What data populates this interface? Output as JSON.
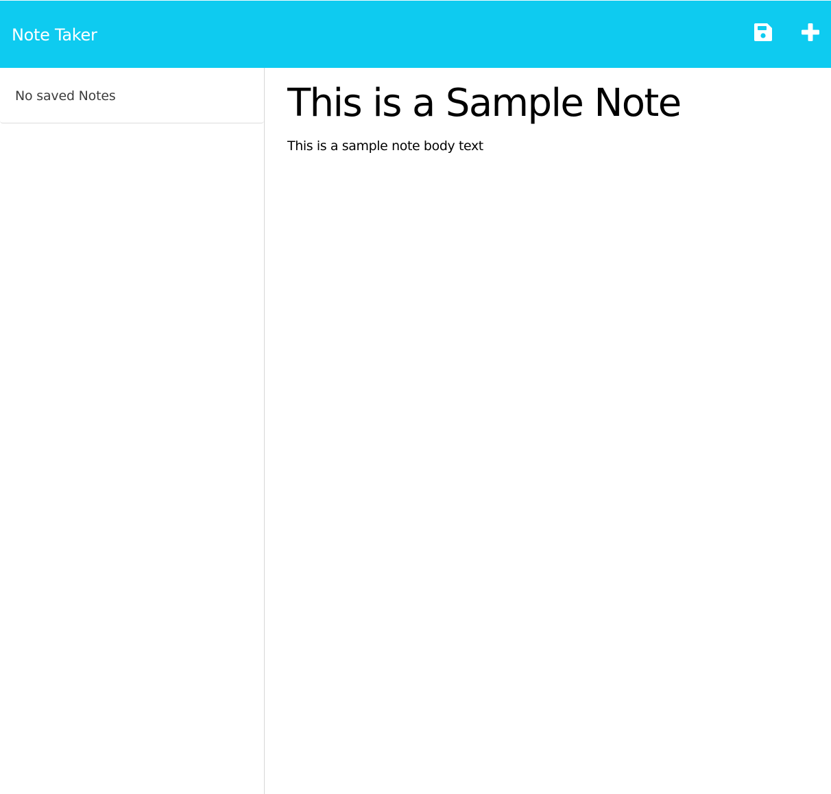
{
  "app": {
    "title": "Note Taker",
    "accent_color": "#0ecbf0"
  },
  "toolbar": {
    "save_icon": "floppy-disk-icon",
    "new_icon": "plus-icon"
  },
  "sidebar": {
    "empty_message": "No saved Notes"
  },
  "editor": {
    "title_value": "This is a Sample Note",
    "body_value": "This is a sample note body text"
  }
}
